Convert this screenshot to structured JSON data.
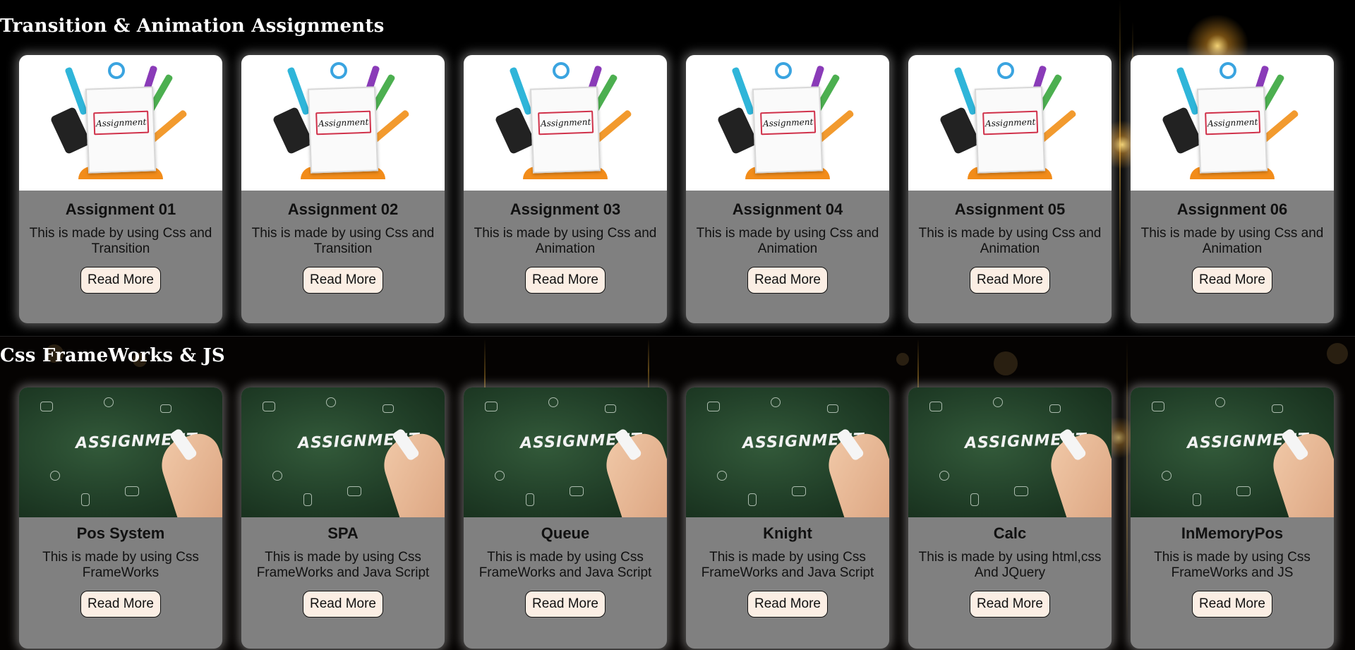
{
  "sections": [
    {
      "title": "Transition & Animation Assignments",
      "image_label": "Assignment",
      "cards": [
        {
          "title": "Assignment 01",
          "description": "This is made by using Css and Transition",
          "button": "Read More"
        },
        {
          "title": "Assignment 02",
          "description": "This is made by using Css and Transition",
          "button": "Read More"
        },
        {
          "title": "Assignment 03",
          "description": "This is made by using Css and Animation",
          "button": "Read More"
        },
        {
          "title": "Assignment 04",
          "description": "This is made by using Css and Animation",
          "button": "Read More"
        },
        {
          "title": "Assignment 05",
          "description": "This is made by using Css and Animation",
          "button": "Read More"
        },
        {
          "title": "Assignment 06",
          "description": "This is made by using Css and Animation",
          "button": "Read More"
        }
      ]
    },
    {
      "title": "Css FrameWorks & JS",
      "image_label": "ASSIGNMENT",
      "cards": [
        {
          "title": "Pos System",
          "description": "This is made by using Css FrameWorks",
          "button": "Read More"
        },
        {
          "title": "SPA",
          "description": "This is made by using Css FrameWorks and Java Script",
          "button": "Read More"
        },
        {
          "title": "Queue",
          "description": "This is made by using Css FrameWorks and Java Script",
          "button": "Read More"
        },
        {
          "title": "Knight",
          "description": "This is made by using Css FrameWorks and Java Script",
          "button": "Read More"
        },
        {
          "title": "Calc",
          "description": "This is made by using html,css And JQuery",
          "button": "Read More"
        },
        {
          "title": "InMemoryPos",
          "description": "This is made by using Css FrameWorks and JS",
          "button": "Read More"
        }
      ]
    }
  ],
  "colors": {
    "background": "#000000",
    "card": "#808080",
    "button": "#fbeee4",
    "accent": "#f2a93b"
  }
}
